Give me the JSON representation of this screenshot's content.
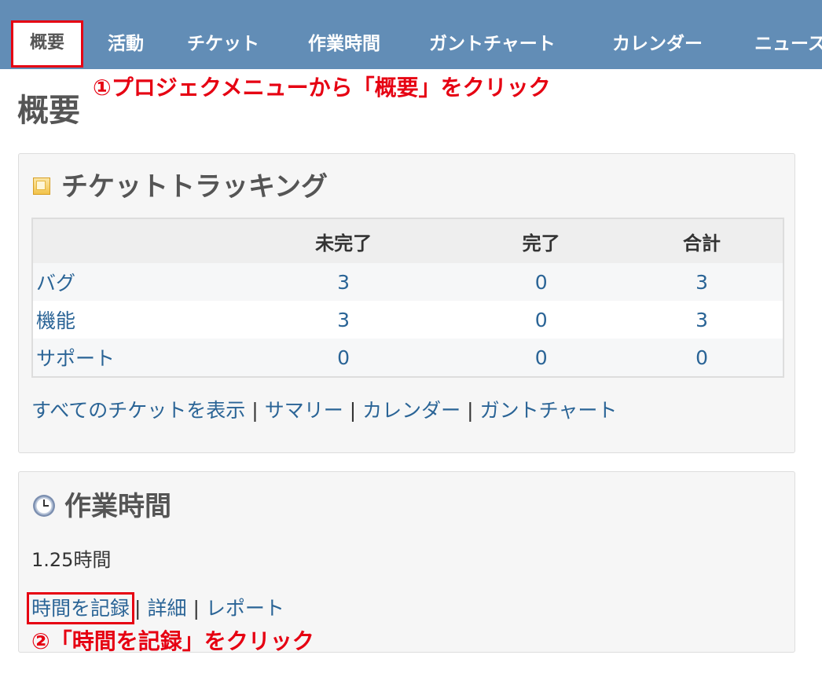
{
  "nav": {
    "tabs": [
      {
        "label": "概要",
        "selected": true
      },
      {
        "label": "活動"
      },
      {
        "label": "チケット"
      },
      {
        "label": "作業時間"
      },
      {
        "label": "ガントチャート"
      },
      {
        "label": "カレンダー"
      },
      {
        "label": "ニュース"
      }
    ]
  },
  "annotations": {
    "step1": "①プロジェクメニューから「概要」をクリック",
    "step2": "②「時間を記録」をクリック",
    "color": "#e60012"
  },
  "page": {
    "title": "概要"
  },
  "issue_tracking": {
    "title": "チケットトラッキング",
    "icon": "ticket-icon",
    "headers": [
      "",
      "未完了",
      "完了",
      "合計"
    ],
    "rows": [
      {
        "tracker": "バグ",
        "open": "3",
        "closed": "0",
        "total": "3"
      },
      {
        "tracker": "機能",
        "open": "3",
        "closed": "0",
        "total": "3"
      },
      {
        "tracker": "サポート",
        "open": "0",
        "closed": "0",
        "total": "0"
      }
    ],
    "links": {
      "all_issues": "すべてのチケットを表示",
      "summary": "サマリー",
      "calendar": "カレンダー",
      "gantt": "ガントチャート",
      "separator": "|"
    }
  },
  "spent_time": {
    "title": "作業時間",
    "icon": "clock-icon",
    "hours": "1.25時間",
    "links": {
      "log_time": "時間を記録",
      "details": "詳細",
      "report": "レポート",
      "separator": "|"
    }
  },
  "colors": {
    "header_bg": "#628db6",
    "link": "#2a6496",
    "box_bg": "#f6f6f6"
  }
}
